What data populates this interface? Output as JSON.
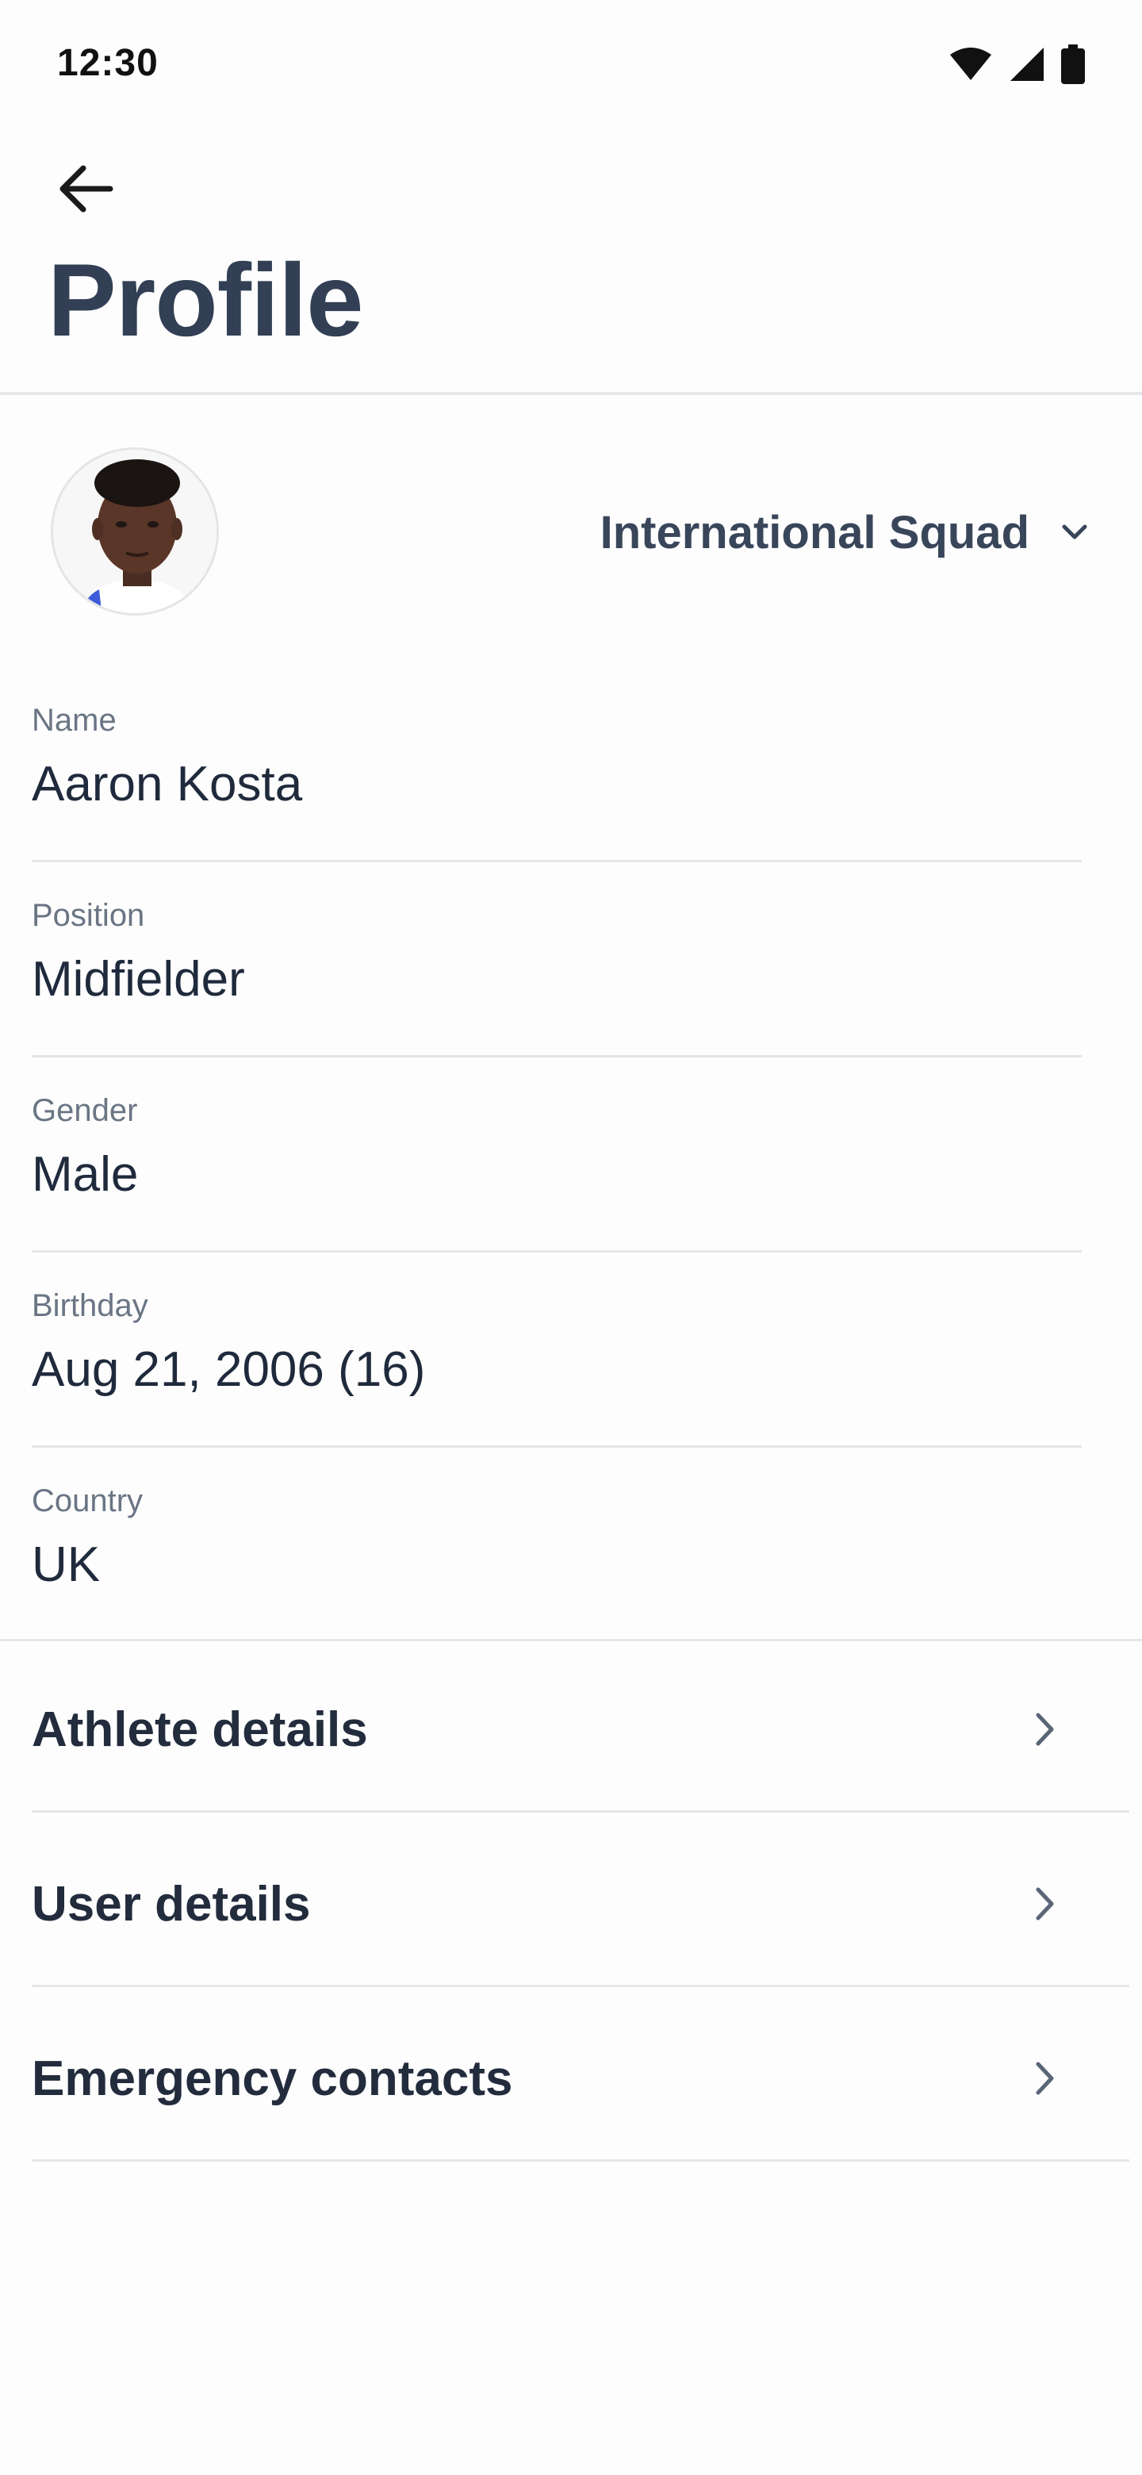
{
  "status_bar": {
    "time": "12:30",
    "icons": [
      "wifi-icon",
      "signal-icon",
      "battery-icon"
    ]
  },
  "header": {
    "back_icon": "arrow-left-icon",
    "title": "Profile"
  },
  "profile": {
    "avatar": "athlete-photo",
    "squad": "International Squad",
    "squad_icon": "chevron-down-icon"
  },
  "fields": [
    {
      "label": "Name",
      "value": "Aaron Kosta"
    },
    {
      "label": "Position",
      "value": "Midfielder"
    },
    {
      "label": "Gender",
      "value": "Male"
    },
    {
      "label": "Birthday",
      "value": "Aug 21, 2006 (16)"
    },
    {
      "label": "Country",
      "value": "UK"
    }
  ],
  "sections": [
    {
      "label": "Athlete details",
      "icon": "chevron-right-icon"
    },
    {
      "label": "User details",
      "icon": "chevron-right-icon"
    },
    {
      "label": "Emergency contacts",
      "icon": "chevron-right-icon"
    }
  ],
  "colors": {
    "title": "#323f54",
    "label": "#6a7584",
    "value": "#1f2a3c",
    "divider": "#e4e6e9",
    "background": "#fdfdfd"
  }
}
